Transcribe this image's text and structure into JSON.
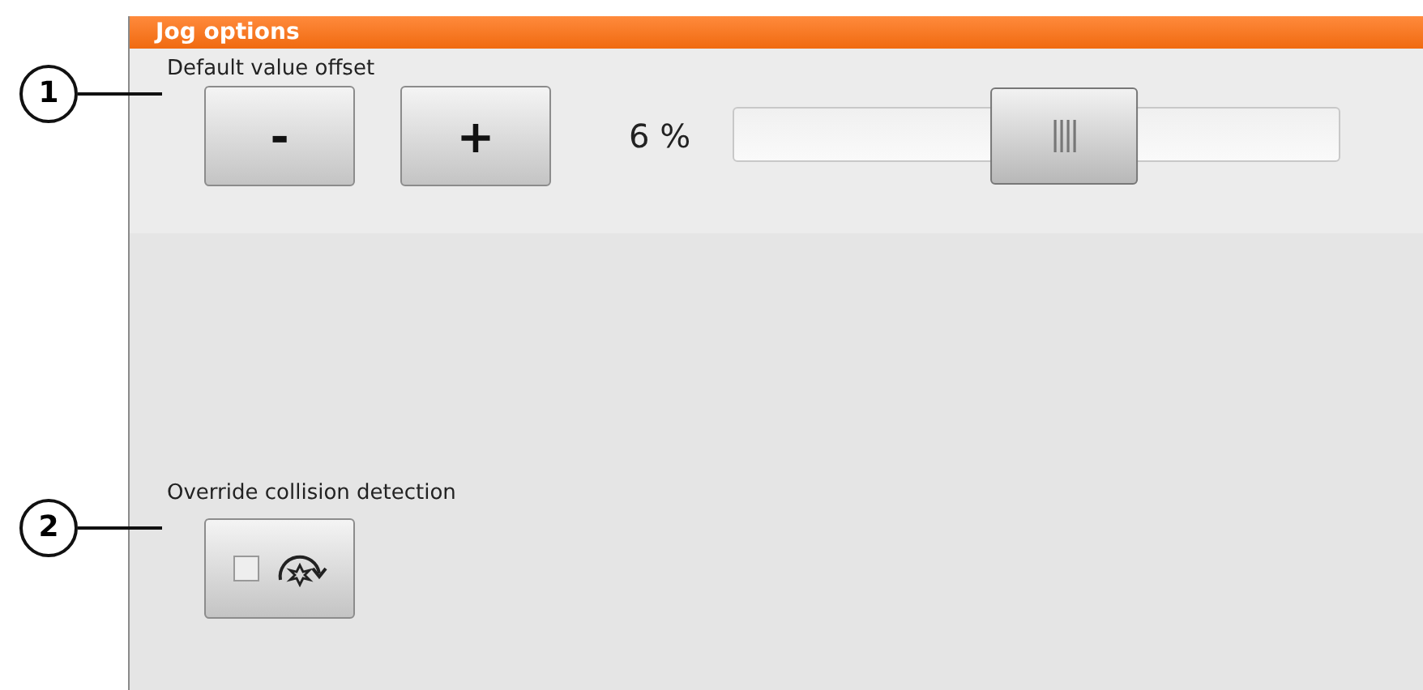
{
  "panel": {
    "title": "Jog options"
  },
  "offset": {
    "label": "Default value offset",
    "decrease": "-",
    "increase": "+",
    "reading": "6 %",
    "level": 0.56
  },
  "collision": {
    "label": "Override collision detection",
    "checked": false
  },
  "callouts": [
    {
      "number": "1"
    },
    {
      "number": "2"
    }
  ]
}
